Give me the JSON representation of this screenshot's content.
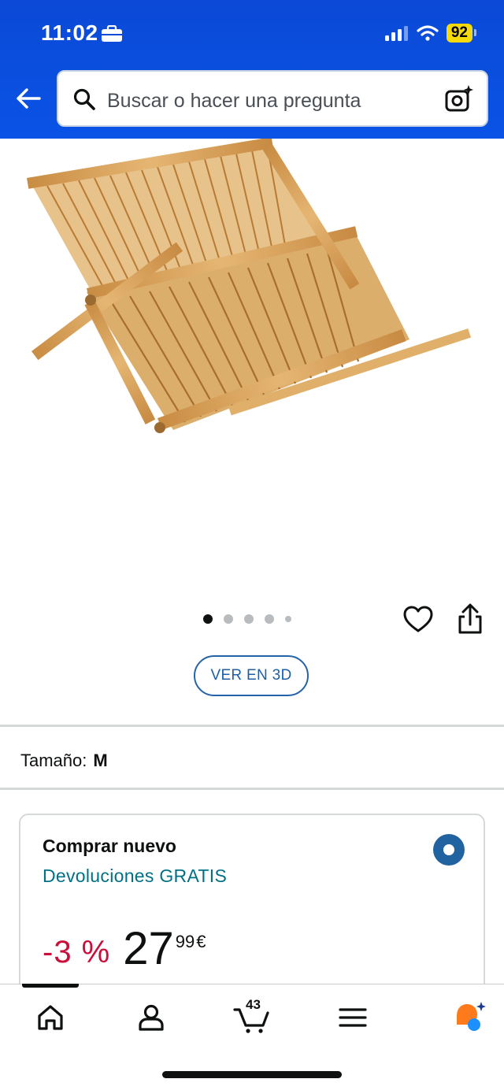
{
  "status_bar": {
    "time": "11:02",
    "battery": "92"
  },
  "header": {
    "search_placeholder": "Buscar o hacer una pregunta"
  },
  "gallery": {
    "dot_count": 5,
    "active_index": 0,
    "view_3d_label": "VER EN 3D"
  },
  "size": {
    "label": "Tamaño:",
    "value": "M"
  },
  "buybox": {
    "title": "Comprar nuevo",
    "returns": "Devoluciones GRATIS",
    "discount": "-3 %",
    "price_whole": "27",
    "price_fraction": "99",
    "currency": "€"
  },
  "bottom_nav": {
    "cart_count": "43",
    "active_tab": "home"
  },
  "colors": {
    "header_blue": "#0a4fe0",
    "link_teal": "#007185",
    "discount_red": "#cc0c39",
    "radio_blue": "#2162a1",
    "bamboo": "#d9a35a"
  }
}
